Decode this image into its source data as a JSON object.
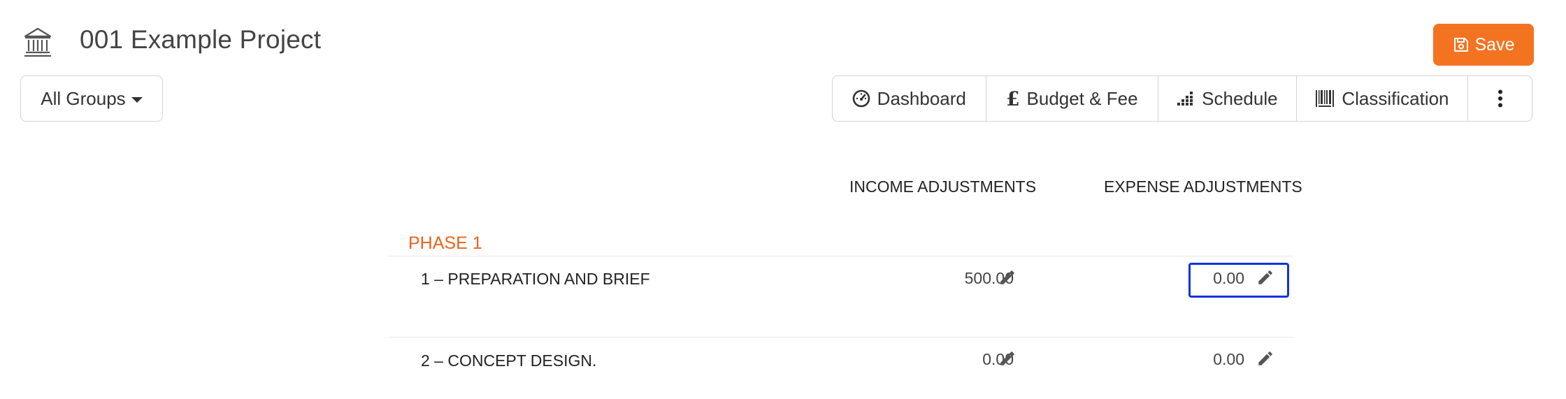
{
  "header": {
    "project_title": "001 Example Project",
    "save_label": "Save",
    "icon": "building-icon"
  },
  "filters": {
    "groups_label": "All Groups"
  },
  "tabs": [
    {
      "label": "Dashboard",
      "icon": "dashboard-gauge-icon"
    },
    {
      "label": "Budget & Fee",
      "icon": "pound-sterling-icon"
    },
    {
      "label": "Schedule",
      "icon": "bar-chart-icon"
    },
    {
      "label": "Classification",
      "icon": "barcode-icon"
    },
    {
      "label": "",
      "icon": "more-vertical-icon"
    }
  ],
  "table": {
    "income_header": "INCOME ADJUSTMENTS",
    "expense_header": "EXPENSE ADJUSTMENTS",
    "phase": "PHASE 1",
    "rows": [
      {
        "label": "1 – PREPARATION AND BRIEF",
        "income": "500.00",
        "expense": "0.00"
      },
      {
        "label": "2 – CONCEPT DESIGN.",
        "income": "0.00",
        "expense": "0.00"
      }
    ]
  },
  "colors": {
    "accent": "#f47321",
    "phase": "#e8641e",
    "focus": "#1133dd"
  }
}
